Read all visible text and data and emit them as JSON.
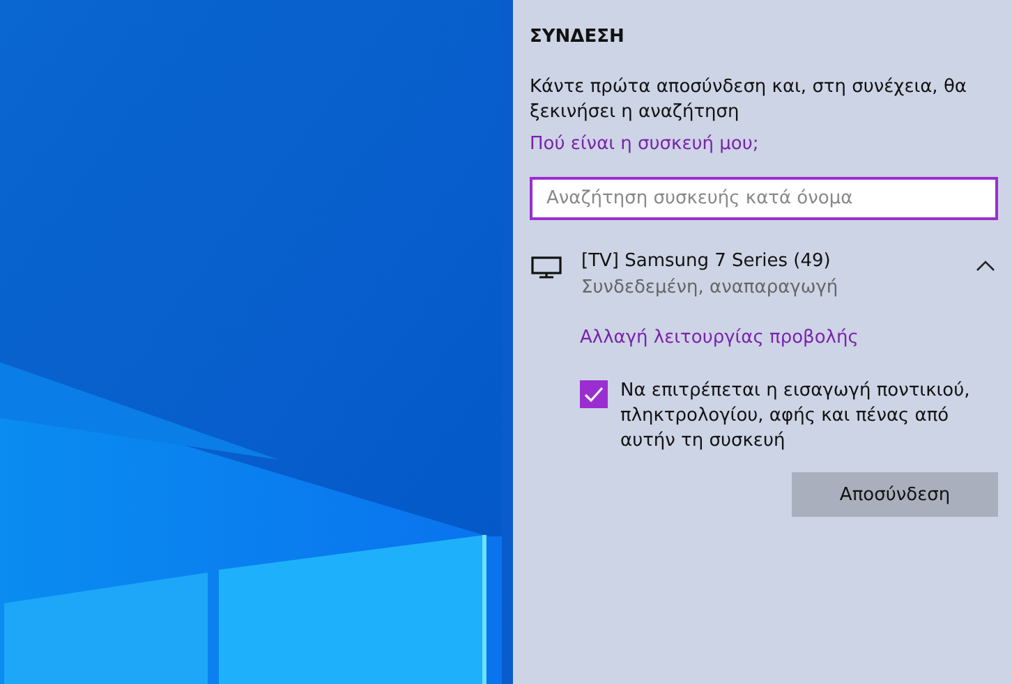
{
  "panel": {
    "title": "ΣΥΝΔΕΣΗ",
    "message": "Κάντε πρώτα αποσύνδεση και, στη συνέχεια, θα ξεκινήσει η αναζήτηση",
    "help_link": "Πού είναι η συσκευή μου;",
    "search": {
      "placeholder": "Αναζήτηση συσκευής κατά όνομα"
    },
    "device": {
      "name": "[TV] Samsung 7 Series (49)",
      "status": "Συνδεδεμένη, αναπαραγωγή",
      "expanded": true,
      "mode_link": "Αλλαγή λειτουργίας προβολής",
      "input_option": {
        "label": "Να επιτρέπεται η εισαγωγή ποντικιού, πληκτρολογίου, αφής και πένας από αυτήν τη συσκευή",
        "checked": true
      },
      "button": "Αποσύνδεση"
    }
  }
}
